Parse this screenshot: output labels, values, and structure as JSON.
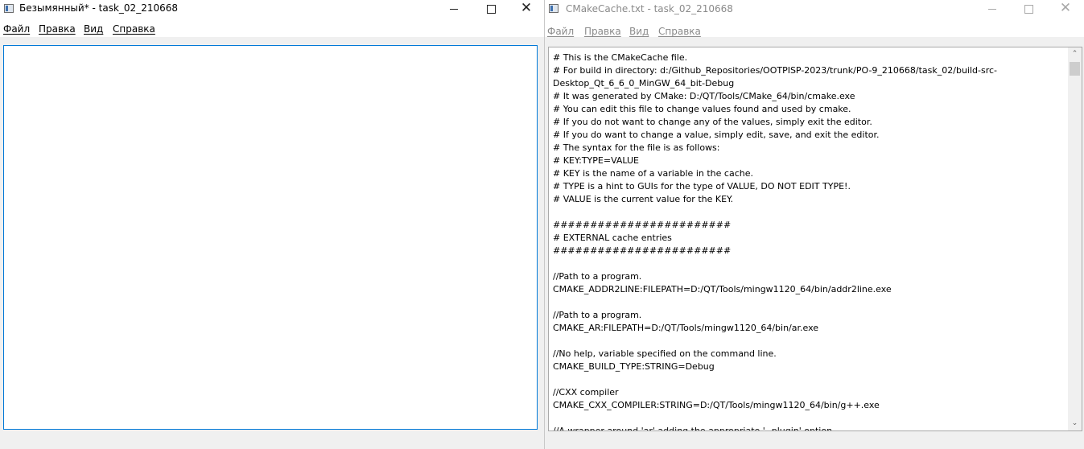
{
  "left_window": {
    "title": "Безымянный* - task_02_210668",
    "controls": {
      "minimize": "",
      "maximize": "",
      "close": "✕"
    },
    "menu": [
      "Файл",
      "Правка",
      "Вид",
      "Справка"
    ],
    "editor_text": ""
  },
  "right_window": {
    "title": "CMakeCache.txt - task_02_210668",
    "controls": {
      "minimize": "",
      "maximize": "",
      "close": "✕"
    },
    "menu": [
      "Файл",
      "Правка",
      "Вид",
      "Справка"
    ],
    "scroll": {
      "up": "⌃",
      "down": "⌄"
    },
    "editor_text": "# This is the CMakeCache file.\n# For build in directory: d:/Github_Repositories/OOTPISP-2023/trunk/PO-9_210668/task_02/build-src-\nDesktop_Qt_6_6_0_MinGW_64_bit-Debug\n# It was generated by CMake: D:/QT/Tools/CMake_64/bin/cmake.exe\n# You can edit this file to change values found and used by cmake.\n# If you do not want to change any of the values, simply exit the editor.\n# If you do want to change a value, simply edit, save, and exit the editor.\n# The syntax for the file is as follows:\n# KEY:TYPE=VALUE\n# KEY is the name of a variable in the cache.\n# TYPE is a hint to GUIs for the type of VALUE, DO NOT EDIT TYPE!.\n# VALUE is the current value for the KEY.\n\n########################\n# EXTERNAL cache entries\n########################\n\n//Path to a program.\nCMAKE_ADDR2LINE:FILEPATH=D:/QT/Tools/mingw1120_64/bin/addr2line.exe\n\n//Path to a program.\nCMAKE_AR:FILEPATH=D:/QT/Tools/mingw1120_64/bin/ar.exe\n\n//No help, variable specified on the command line.\nCMAKE_BUILD_TYPE:STRING=Debug\n\n//CXX compiler\nCMAKE_CXX_COMPILER:STRING=D:/QT/Tools/mingw1120_64/bin/g++.exe\n\n//A wrapper around 'ar' adding the appropriate '--plugin' option"
  }
}
